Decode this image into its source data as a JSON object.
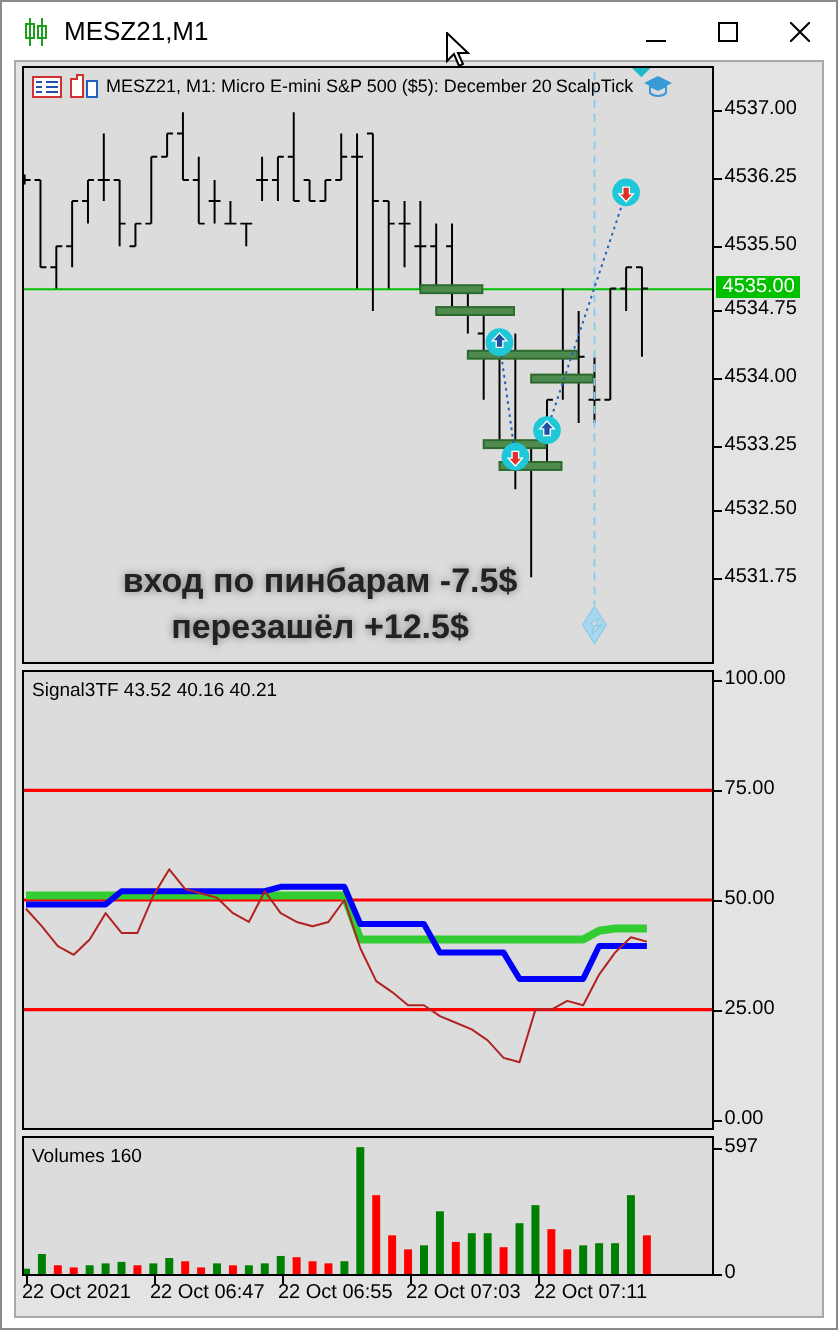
{
  "window": {
    "title": "MESZ21,M1"
  },
  "chart": {
    "header": "MESZ21, M1:  Micro E-mini S&P 500 ($5): December 20",
    "expert": "ScalpTick",
    "price_ticks": [
      "4537.00",
      "4536.25",
      "4535.50",
      "4534.75",
      "4534.00",
      "4533.25",
      "4532.50",
      "4531.75"
    ],
    "current_price": "4535.00",
    "note_lines": [
      "вход по пинбарам -7.5$",
      "перезашёл +12.5$"
    ]
  },
  "indicator": {
    "label": "Signal3TF 43.52 40.16 40.21",
    "chart_data": {
      "type": "line",
      "ylim": [
        -2,
        102
      ],
      "yticks": [
        {
          "value": 100,
          "label": "100.00"
        },
        {
          "value": 75,
          "label": "75.00"
        },
        {
          "value": 50,
          "label": "50.00"
        },
        {
          "value": 25,
          "label": "25.00"
        },
        {
          "value": 0,
          "label": "0.00"
        }
      ],
      "grid": true,
      "series": [
        {
          "color": "#32cd32",
          "values": [
            51,
            51,
            51,
            51,
            51,
            51,
            51,
            51,
            51,
            51,
            51,
            51,
            51,
            51,
            51,
            51,
            51,
            51,
            51,
            51,
            51,
            41,
            41,
            41,
            41,
            41,
            41,
            41,
            41,
            41,
            41,
            41,
            41,
            41,
            41,
            41,
            43,
            43.5,
            43.5,
            43.5
          ]
        },
        {
          "color": "#0000ff",
          "values": [
            49,
            49,
            49,
            49,
            49,
            49,
            52,
            52,
            52,
            52,
            52,
            52,
            52,
            52,
            52,
            52,
            53,
            53,
            53,
            53,
            53,
            44.5,
            44.5,
            44.5,
            44.5,
            44.5,
            38,
            38,
            38,
            38,
            38,
            32,
            32,
            32,
            32,
            32,
            39.5,
            39.5,
            39.5,
            39.5
          ]
        },
        {
          "color": "#b22222",
          "values": [
            48,
            44,
            39.5,
            37.5,
            41,
            47,
            42.5,
            42.5,
            51,
            57,
            52.5,
            51.5,
            50.5,
            47,
            45,
            52,
            47,
            45,
            44,
            45,
            50,
            39,
            31.5,
            29,
            26,
            26,
            23.5,
            22,
            20.5,
            18,
            14,
            13,
            25,
            25,
            27,
            26,
            33,
            38,
            41.5,
            40.5
          ]
        }
      ]
    }
  },
  "volumes": {
    "label": "Volumes 160",
    "time_axis": [
      "22 Oct 2021",
      "22 Oct 06:47",
      "22 Oct 06:55",
      "22 Oct 07:03",
      "22 Oct 07:11"
    ],
    "chart_data": {
      "type": "bar",
      "ylim": [
        0,
        640
      ],
      "yticks": [
        {
          "value": 597,
          "label": "597"
        },
        {
          "value": 0,
          "label": "0"
        }
      ],
      "series": [
        {
          "color": "#008000",
          "values": [
            25,
            94,
            null,
            null,
            41,
            50,
            57,
            null,
            50,
            75,
            null,
            null,
            50,
            null,
            41,
            50,
            85,
            null,
            null,
            null,
            60,
            597,
            null,
            null,
            null,
            135,
            295,
            null,
            192,
            192,
            null,
            239,
            324,
            null,
            null,
            135,
            145,
            145,
            371,
            null
          ]
        },
        {
          "color": "#ff0000",
          "values": [
            null,
            null,
            41,
            31,
            null,
            null,
            null,
            41,
            null,
            null,
            60,
            31,
            null,
            41,
            null,
            null,
            null,
            79,
            60,
            50,
            null,
            null,
            371,
            182,
            116,
            null,
            null,
            151,
            null,
            null,
            126,
            null,
            null,
            211,
            116,
            null,
            null,
            null,
            null,
            182
          ]
        }
      ]
    }
  }
}
